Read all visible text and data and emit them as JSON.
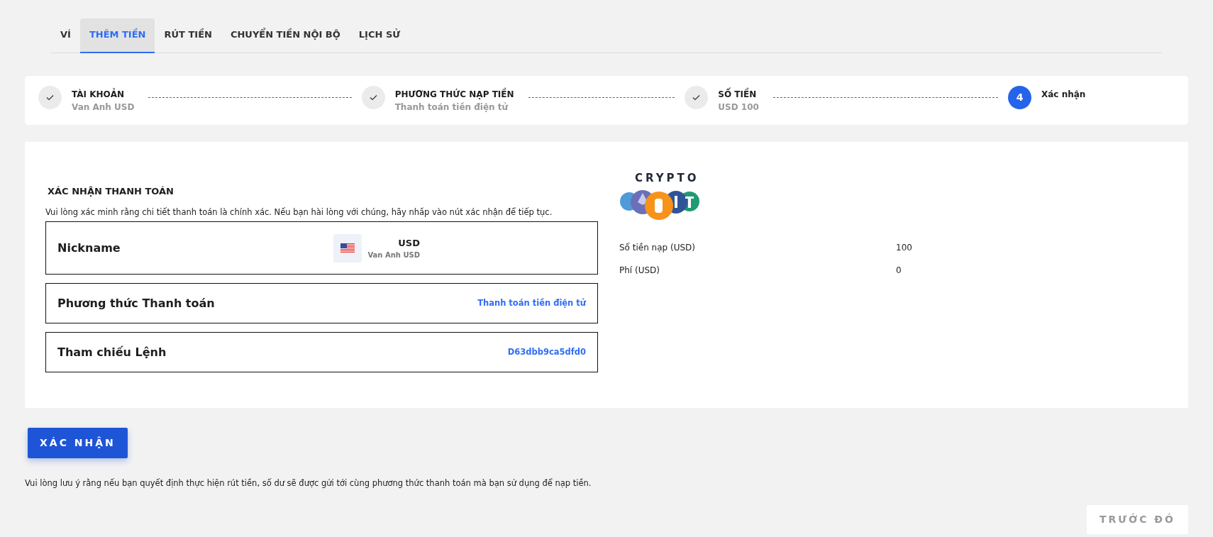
{
  "tabs": [
    {
      "label": "VÍ",
      "selected": false
    },
    {
      "label": "THÊM TIỀN",
      "selected": true
    },
    {
      "label": "RÚT TIỀN",
      "selected": false
    },
    {
      "label": "CHUYỂN TIỀN NỘI BỘ",
      "selected": false
    },
    {
      "label": "LỊCH SỬ",
      "selected": false
    }
  ],
  "steps": [
    {
      "title": "TÀI KHOẢN",
      "subtitle": "Van Anh USD",
      "done": true
    },
    {
      "title": "PHƯƠNG THỨC NẠP TIỀN",
      "subtitle": "Thanh toán tiền điện tử",
      "done": true
    },
    {
      "title": "SỐ TIỀN",
      "subtitle": "USD 100",
      "done": true
    },
    {
      "number": "4",
      "title": "Xác nhận",
      "done": false
    }
  ],
  "confirmation": {
    "title": "XÁC NHẬN THANH TOÁN",
    "description": "Vui lòng xác minh rằng chi tiết thanh toán là chính xác. Nếu bạn hài lòng với chúng, hãy nhấp vào nút xác nhận để tiếp tục.",
    "rows": [
      {
        "kind": "account",
        "label": "Nickname",
        "currency": "USD",
        "account_name": "Van Anh USD"
      },
      {
        "kind": "text",
        "label": "Phương thức Thanh toán",
        "value": "Thanh toán tiền điện tử"
      },
      {
        "kind": "text",
        "label": "Tham chiếu Lệnh",
        "value": "D63dbb9ca5dfd0"
      }
    ]
  },
  "summary": {
    "logo_text": "CRYPTO",
    "rows": [
      {
        "label": "Số tiền nạp (USD)",
        "value": "100"
      },
      {
        "label": "Phí (USD)",
        "value": "0"
      }
    ]
  },
  "confirm_button": "XÁC NHẬN",
  "note": "Vui lòng lưu ý rằng nếu bạn quyết định thực hiện rút tiền, số dư sẽ được gửi tới cùng phương thức thanh toán mà bạn sử dụng để nạp tiền.",
  "back_button": "TRƯỚC ĐÓ"
}
